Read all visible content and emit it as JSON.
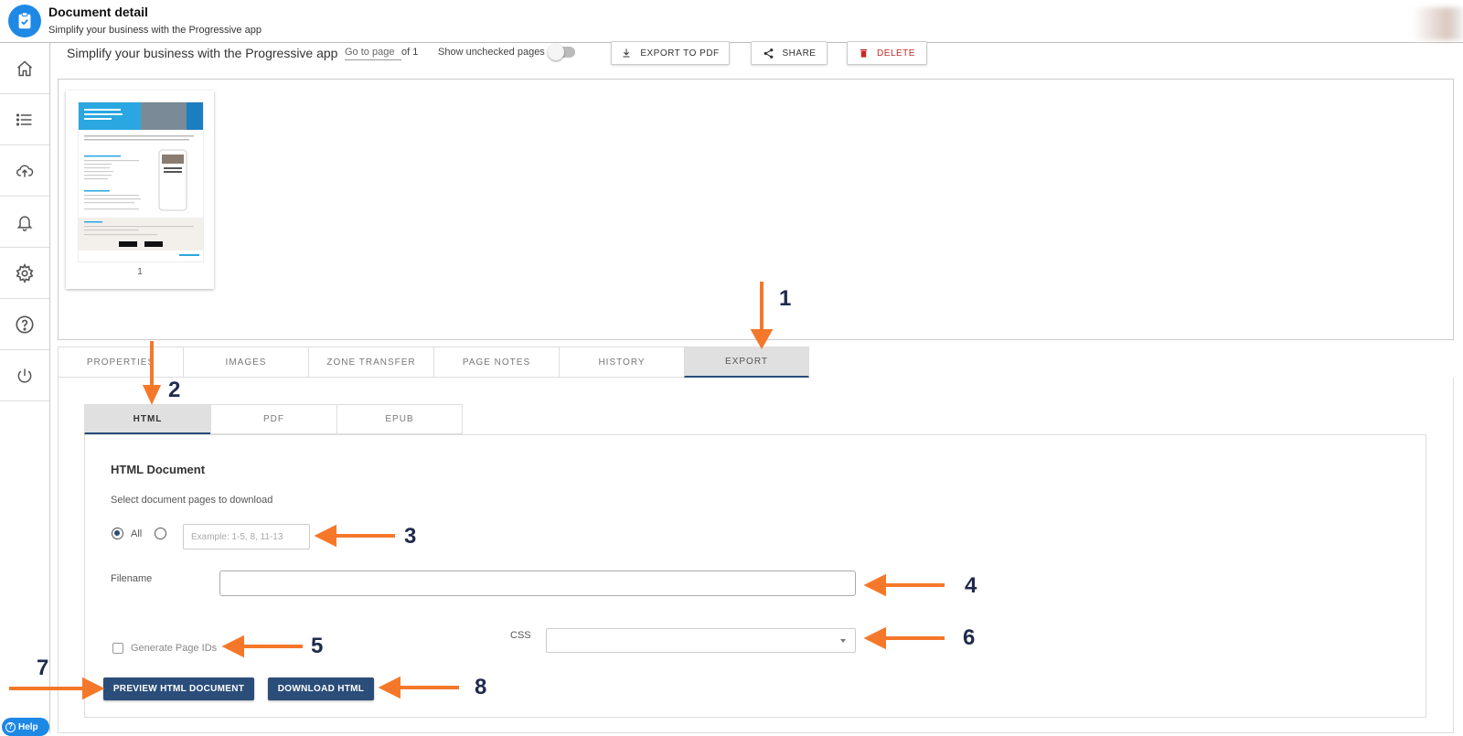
{
  "header": {
    "title": "Document detail",
    "subtitle": "Simplify your business with the Progressive app"
  },
  "sidebar": {
    "items": [
      {
        "icon": "home-icon"
      },
      {
        "icon": "list-icon"
      },
      {
        "icon": "cloud-upload-icon"
      },
      {
        "icon": "bell-icon"
      },
      {
        "icon": "gear-icon"
      },
      {
        "icon": "help-circle-icon"
      },
      {
        "icon": "power-icon"
      }
    ],
    "help_label": "Help"
  },
  "toolbar": {
    "document_name": "Simplify your business with the Progressive app",
    "goto_placeholder": "Go to page",
    "of_label": "of 1",
    "show_unchecked_label": "Show unchecked pages",
    "export_pdf_label": "EXPORT TO PDF",
    "share_label": "SHARE",
    "delete_label": "DELETE",
    "delete_color": "#c62828"
  },
  "thumbnails": [
    {
      "page_number": "1"
    }
  ],
  "tabs": [
    {
      "label": "PROPERTIES",
      "active": false
    },
    {
      "label": "IMAGES",
      "active": false
    },
    {
      "label": "ZONE TRANSFER",
      "active": false
    },
    {
      "label": "PAGE NOTES",
      "active": false
    },
    {
      "label": "HISTORY",
      "active": false
    },
    {
      "label": "EXPORT",
      "active": true
    }
  ],
  "export": {
    "subtabs": [
      {
        "label": "HTML",
        "active": true
      },
      {
        "label": "PDF",
        "active": false
      },
      {
        "label": "EPUB",
        "active": false
      }
    ],
    "section_title": "HTML Document",
    "select_pages_label": "Select document pages to download",
    "radio_all_label": "All",
    "page_range_placeholder": "Example: 1-5, 8, 11-13",
    "filename_label": "Filename",
    "filename_value": "",
    "generate_ids_label": "Generate Page IDs",
    "css_label": "CSS",
    "css_value": "",
    "preview_button": "PREVIEW HTML DOCUMENT",
    "download_button": "DOWNLOAD HTML"
  },
  "annotations": [
    "1",
    "2",
    "3",
    "4",
    "5",
    "6",
    "7",
    "8"
  ],
  "colors": {
    "accent": "#1e88e5",
    "primary_button": "#2b4d7a",
    "annotation_arrow": "#f5782a",
    "annotation_number": "#1f2a4d"
  }
}
